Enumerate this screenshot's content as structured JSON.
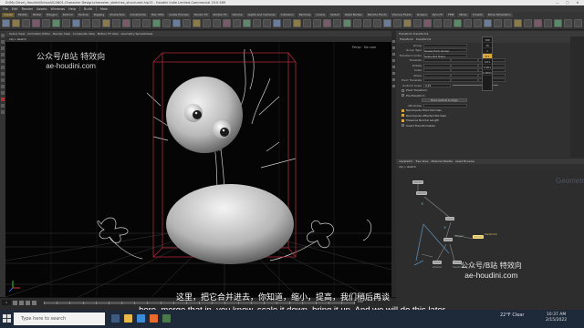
{
  "window": {
    "title": "D:\\My Drive\\_Houdini\\School\\ICAN01-Character Design\\character_sketches_structured.hip13 - Houdini Indie Limited-Commercial 19.0.589",
    "controls": [
      "—",
      "□",
      "✕"
    ]
  },
  "menu": {
    "items": [
      "File",
      "Edit",
      "Render",
      "Assets",
      "Windows",
      "Help"
    ],
    "build": "Build",
    "workspace": "Main"
  },
  "shelf": {
    "tabs": [
      "Create",
      "Modify",
      "Model",
      "Polygon",
      "Deform",
      "Texture",
      "Rigging",
      "Characters",
      "Constraints",
      "Hair Utils",
      "Guide Process",
      "Terrain FX",
      "Simple FX",
      "Volume",
      "Lights and Cameras",
      "Collisions",
      "Particles",
      "Grains",
      "Vellum",
      "Rigid Bodies",
      "Particle Fluids",
      "Viscous Fluids",
      "Oceans",
      "Pyro FX",
      "FEM",
      "Wires",
      "Crowds",
      "Drive Simulation"
    ]
  },
  "viewport": {
    "tabs": [
      "Scene View",
      "Animation Editor",
      "Render View",
      "Composite View",
      "Motion FX View",
      "Geometry Spreadsheet"
    ],
    "path": "obj > sketch",
    "label": "Persp",
    "cam": "No cam"
  },
  "watermark": {
    "line1": "公众号/B站 特效向",
    "line2": "ae-houdini.com"
  },
  "network": {
    "label": "Geometry",
    "tabs": [
      "obj/sketch",
      "Tree View",
      "Material Palette",
      "Asset Browser"
    ],
    "path": "obj > sketch",
    "nodes": [
      "transform1",
      "merge2",
      "sphere1",
      "transform2"
    ]
  },
  "params": {
    "node_type": "Transform",
    "node_name": "transform1",
    "group_label": "Group",
    "group_type_label": "Group Type",
    "group_type_value": "Guess from Group",
    "xform_order_label": "Transform Order",
    "xform_order_value": "Scale Rot Trans",
    "translate_label": "Translate",
    "rotate_label": "Rotate",
    "scale_label": "Scale",
    "shear_label": "Shear",
    "pivot_label": "Pivot Translate",
    "uniform_scale_label": "Uniform Scale",
    "uniform_scale_value": "0.25",
    "pivot_xform_label": "Pivot Transform",
    "pre_xform_label": "Pre-Transform",
    "move_centroid_label": "Move Centroid to Origin",
    "attributes_label": "Attributes",
    "checks": [
      "Recompute Point Normals",
      "Recompute Affected Normals",
      "Preserve Normal Length",
      "Invert Transformation"
    ],
    "ladder": [
      "100",
      "10",
      "1",
      "0.1",
      "0.01",
      "0.001",
      "0.0001"
    ],
    "ladder_active": "0.1"
  },
  "playbar": {
    "frame": "1",
    "end_frame": "240"
  },
  "subtitles": {
    "zh": "这里，把它合并进去，你知道，缩小，提高，我们稍后再谈",
    "en": "here, merge that in, you know, scale it down, bring it up. And we will do this later"
  },
  "taskbar": {
    "search_placeholder": "Type here to search",
    "weather": "22°F  Clear",
    "time": "10:37 AM",
    "date": "2/15/2022"
  },
  "colors": {
    "accent": "#d6a640",
    "viewport_bg": "#050505",
    "bbox": "#b0283a",
    "panel_bg": "#303030",
    "taskbar_bg": "#1e2a3a"
  }
}
